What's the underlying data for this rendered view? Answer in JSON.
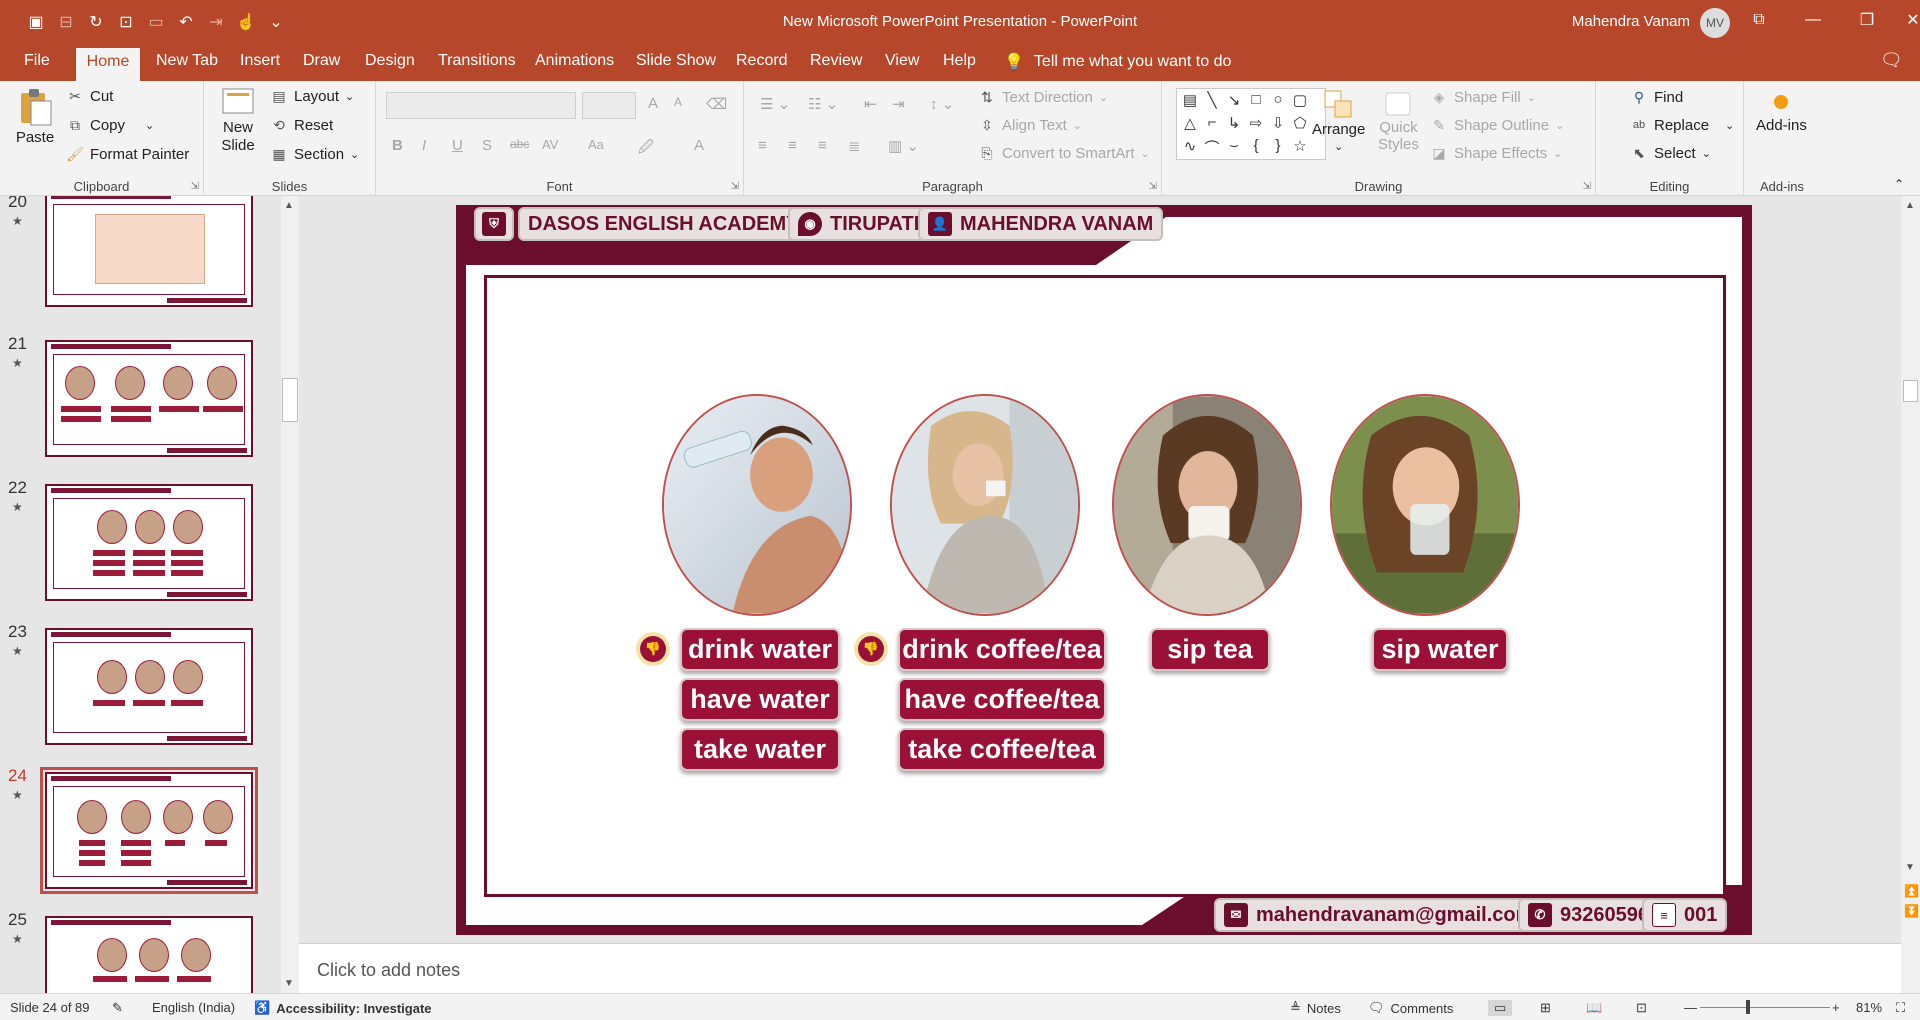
{
  "window": {
    "title": "New Microsoft PowerPoint Presentation - PowerPoint",
    "user_name": "Mahendra Vanam",
    "user_initials": "MV",
    "accent": "#b7472a"
  },
  "quick_access": [
    "save-icon",
    "autosave-icon",
    "redo-icon",
    "present-icon",
    "touch-icon",
    "undo-icon",
    "indent-icon",
    "touch-mode-icon",
    "more-icon"
  ],
  "tabs": [
    "File",
    "Home",
    "New Tab",
    "Insert",
    "Draw",
    "Design",
    "Transitions",
    "Animations",
    "Slide Show",
    "Record",
    "Review",
    "View",
    "Help"
  ],
  "tell_me": "Tell me what you want to do",
  "ribbon": {
    "clipboard": {
      "label": "Clipboard",
      "paste": "Paste",
      "cut": "Cut",
      "copy": "Copy",
      "format_painter": "Format Painter"
    },
    "slides": {
      "label": "Slides",
      "new_slide_1": "New",
      "new_slide_2": "Slide",
      "layout": "Layout",
      "reset": "Reset",
      "section": "Section"
    },
    "font": {
      "label": "Font",
      "bold": "B",
      "italic": "I",
      "underline": "U",
      "shadow": "S",
      "strike": "abc",
      "spacing": "AV",
      "case": "Aa",
      "grow": "A",
      "shrink": "A",
      "color": "A"
    },
    "paragraph": {
      "label": "Paragraph",
      "text_direction": "Text Direction",
      "align_text": "Align Text",
      "smartart": "Convert to SmartArt"
    },
    "drawing": {
      "label": "Drawing",
      "arrange": "Arrange",
      "quick_1": "Quick",
      "quick_2": "Styles",
      "shape_fill": "Shape Fill",
      "shape_outline": "Shape Outline",
      "shape_effects": "Shape Effects"
    },
    "editing": {
      "label": "Editing",
      "find": "Find",
      "replace": "Replace",
      "select": "Select"
    },
    "addins": {
      "label": "Add-ins",
      "addins": "Add-ins"
    }
  },
  "thumbnails": [
    {
      "number": "20",
      "star": "★"
    },
    {
      "number": "21",
      "star": "★"
    },
    {
      "number": "22",
      "star": "★"
    },
    {
      "number": "23",
      "star": "★"
    },
    {
      "number": "24",
      "star": "★"
    },
    {
      "number": "25",
      "star": "★"
    }
  ],
  "slide": {
    "header": {
      "academy": "DASOS ENGLISH ACADEMY",
      "city": "TIRUPATI",
      "teacher": "MAHENDRA VANAM"
    },
    "footer": {
      "email": "mahendravanam@gmail.com",
      "phone": "9326059612",
      "code": "001"
    },
    "columns": [
      {
        "labels": [
          "drink water",
          "have water",
          "take water"
        ]
      },
      {
        "labels": [
          "drink coffee/tea",
          "have coffee/tea",
          "take coffee/tea"
        ]
      },
      {
        "labels": [
          "sip tea"
        ]
      },
      {
        "labels": [
          "sip water"
        ]
      }
    ]
  },
  "notes_placeholder": "Click to add notes",
  "status": {
    "slide_pos": "Slide 24 of 89",
    "language": "English (India)",
    "accessibility": "Accessibility: Investigate",
    "notes": "Notes",
    "comments": "Comments",
    "zoom": "81%"
  }
}
